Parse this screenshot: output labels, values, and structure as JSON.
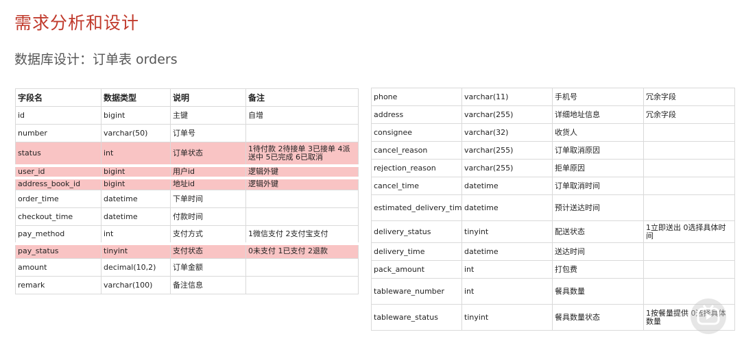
{
  "slide": {
    "title": "需求分析和设计",
    "subtitle": "数据库设计：订单表 orders"
  },
  "left_table": {
    "headers": [
      "字段名",
      "数据类型",
      "说明",
      "备注"
    ],
    "rows": [
      {
        "field": "id",
        "type": "bigint",
        "desc": "主键",
        "note": "自增",
        "highlight": false
      },
      {
        "field": "number",
        "type": "varchar(50)",
        "desc": "订单号",
        "note": "",
        "highlight": false
      },
      {
        "field": "status",
        "type": "int",
        "desc": "订单状态",
        "note": "1待付款 2待接单 3已接单 4派送中 5已完成 6已取消",
        "highlight": true
      },
      {
        "field": "user_id",
        "type": "bigint",
        "desc": "用户id",
        "note": "逻辑外键",
        "highlight": true
      },
      {
        "field": "address_book_id",
        "type": "bigint",
        "desc": "地址id",
        "note": "逻辑外键",
        "highlight": true
      },
      {
        "field": "order_time",
        "type": "datetime",
        "desc": "下单时间",
        "note": "",
        "highlight": false
      },
      {
        "field": "checkout_time",
        "type": "datetime",
        "desc": "付款时间",
        "note": "",
        "highlight": false
      },
      {
        "field": "pay_method",
        "type": "int",
        "desc": "支付方式",
        "note": "1微信支付 2支付宝支付",
        "highlight": false
      },
      {
        "field": "pay_status",
        "type": "tinyint",
        "desc": "支付状态",
        "note": "0未支付 1已支付 2退款",
        "highlight": true
      },
      {
        "field": "amount",
        "type": "decimal(10,2)",
        "desc": "订单金额",
        "note": "",
        "highlight": false
      },
      {
        "field": "remark",
        "type": "varchar(100)",
        "desc": "备注信息",
        "note": "",
        "highlight": false
      }
    ]
  },
  "right_table": {
    "rows": [
      {
        "field": "phone",
        "type": "varchar(11)",
        "desc": "手机号",
        "note": "冗余字段"
      },
      {
        "field": "address",
        "type": "varchar(255)",
        "desc": "详细地址信息",
        "note": "冗余字段"
      },
      {
        "field": "consignee",
        "type": "varchar(32)",
        "desc": "收货人",
        "note": ""
      },
      {
        "field": "cancel_reason",
        "type": "varchar(255)",
        "desc": "订单取消原因",
        "note": ""
      },
      {
        "field": "rejection_reason",
        "type": "varchar(255)",
        "desc": "拒单原因",
        "note": ""
      },
      {
        "field": "cancel_time",
        "type": "datetime",
        "desc": "订单取消时间",
        "note": ""
      },
      {
        "field": "estimated_delivery_time",
        "type": "datetime",
        "desc": "预计送达时间",
        "note": ""
      },
      {
        "field": "delivery_status",
        "type": "tinyint",
        "desc": "配送状态",
        "note": "1立即送出 0选择具体时间"
      },
      {
        "field": "delivery_time",
        "type": "datetime",
        "desc": "送达时间",
        "note": ""
      },
      {
        "field": "pack_amount",
        "type": "int",
        "desc": "打包费",
        "note": ""
      },
      {
        "field": "tableware_number",
        "type": "int",
        "desc": "餐具数量",
        "note": ""
      },
      {
        "field": "tableware_status",
        "type": "tinyint",
        "desc": "餐具数量状态",
        "note": "1按餐量提供 0选择具体数量"
      }
    ]
  },
  "colors": {
    "title": "#c0392b",
    "highlight_row": "#f9c4c4",
    "border": "#d9d9d9"
  },
  "watermark_icon": "video-player-logo-icon"
}
